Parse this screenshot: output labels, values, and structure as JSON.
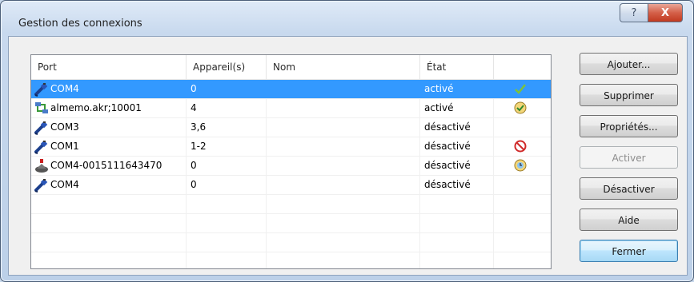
{
  "window": {
    "title": "Gestion des connexions",
    "help_glyph": "?",
    "close_glyph": "X"
  },
  "table": {
    "columns": [
      "Port",
      "Appareil(s)",
      "Nom",
      "État",
      ""
    ],
    "rows": [
      {
        "port": "COM4",
        "devices": "0",
        "name": "",
        "state": "activé",
        "port_icon": "usb-cable-icon",
        "status_icon": "checkmark-icon",
        "selected": true
      },
      {
        "port": "almemo.akr;10001",
        "devices": "4",
        "name": "",
        "state": "activé",
        "port_icon": "network-icon",
        "status_icon": "clock-check-icon",
        "selected": false
      },
      {
        "port": "COM3",
        "devices": "3,6",
        "name": "",
        "state": "désactivé",
        "port_icon": "usb-cable-icon",
        "status_icon": "",
        "selected": false
      },
      {
        "port": "COM1",
        "devices": "1-2",
        "name": "",
        "state": "désactivé",
        "port_icon": "usb-cable-icon",
        "status_icon": "no-entry-icon",
        "selected": false
      },
      {
        "port": "COM4-0015111643470",
        "devices": "0",
        "name": "",
        "state": "désactivé",
        "port_icon": "bluetooth-device-icon",
        "status_icon": "clock-icon",
        "selected": false
      },
      {
        "port": "COM4",
        "devices": "0",
        "name": "",
        "state": "désactivé",
        "port_icon": "usb-cable-icon",
        "status_icon": "",
        "selected": false
      }
    ]
  },
  "buttons": {
    "add": "Ajouter...",
    "remove": "Supprimer",
    "properties": "Propriétés...",
    "activate": "Activer",
    "deactivate": "Désactiver",
    "help": "Aide",
    "close": "Fermer"
  },
  "colors": {
    "selection": "#3399ff",
    "title_bar": "#c8d9ee",
    "close_button": "#c13a21"
  }
}
